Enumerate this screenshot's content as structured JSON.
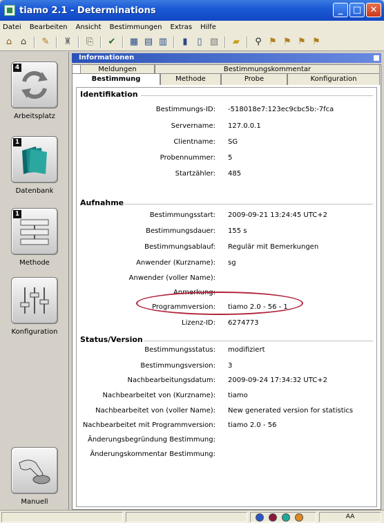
{
  "window": {
    "title": "tiamo 2.1 - Determinations"
  },
  "menu": [
    "Datei",
    "Bearbeiten",
    "Ansicht",
    "Bestimmungen",
    "Extras",
    "Hilfe"
  ],
  "sidebar": {
    "items": [
      {
        "label": "Arbeitsplatz",
        "badge": "4"
      },
      {
        "label": "Datenbank",
        "badge": "1"
      },
      {
        "label": "Methode",
        "badge": "1"
      },
      {
        "label": "Konfiguration",
        "badge": ""
      },
      {
        "label": "Manuell",
        "badge": ""
      }
    ]
  },
  "panel": {
    "title": "Informationen",
    "tabs_top": [
      "Meldungen",
      "Bestimmungskommentar"
    ],
    "tabs_bottom": [
      "Bestimmung",
      "Methode",
      "Probe",
      "Konfiguration"
    ]
  },
  "sections": {
    "identifikation": "Identifikation",
    "aufnahme": "Aufnahme",
    "status": "Status/Version"
  },
  "fields": {
    "bestimmungs_id": {
      "label": "Bestimmungs-ID:",
      "value": "-518018e7:123ec9cbc5b:-7fca"
    },
    "servername": {
      "label": "Servername:",
      "value": "127.0.0.1"
    },
    "clientname": {
      "label": "Clientname:",
      "value": "SG"
    },
    "probennummer": {
      "label": "Probennummer:",
      "value": "5"
    },
    "startzaehler": {
      "label": "Startzähler:",
      "value": "485"
    },
    "bestimmungsstart": {
      "label": "Bestimmungsstart:",
      "value": "2009-09-21 13:24:45 UTC+2"
    },
    "bestimmungsdauer": {
      "label": "Bestimmungsdauer:",
      "value": "155 s"
    },
    "bestimmungsablauf": {
      "label": "Bestimmungsablauf:",
      "value": "Regulär mit Bemerkungen"
    },
    "anwender_kurz": {
      "label": "Anwender (Kurzname):",
      "value": "sg"
    },
    "anwender_voll": {
      "label": "Anwender (voller Name):",
      "value": ""
    },
    "anmerkung": {
      "label": "Anmerkung:",
      "value": ""
    },
    "programmversion": {
      "label": "Programmversion:",
      "value": "tiamo 2.0 - 56 - 1"
    },
    "lizenz_id": {
      "label": "Lizenz-ID:",
      "value": "6274773"
    },
    "bestimmungsstatus": {
      "label": "Bestimmungsstatus:",
      "value": "modifiziert"
    },
    "bestimmungsversion": {
      "label": "Bestimmungsversion:",
      "value": "3"
    },
    "nachbearbeitungsdatum": {
      "label": "Nachbearbeitungsdatum:",
      "value": "2009-09-24 17:34:32 UTC+2"
    },
    "nachbearbeitet_kurz": {
      "label": "Nachbearbeitet von (Kurzname):",
      "value": "tiamo"
    },
    "nachbearbeitet_voll": {
      "label": "Nachbearbeitet von (voller Name):",
      "value": "New generated version for statistics"
    },
    "nachbearbeitet_programm": {
      "label": "Nachbearbeitet mit Programmversion:",
      "value": "tiamo 2.0 - 56"
    },
    "aenderungsbegruendung": {
      "label": "Änderungsbegründung Bestimmung:",
      "value": ""
    },
    "aenderungskommentar": {
      "label": "Änderungskommentar Bestimmung:",
      "value": ""
    }
  },
  "statusbar": {
    "right_text": "AA"
  },
  "colors": {
    "dot1": "#2a56c8",
    "dot2": "#8a1a3a",
    "dot3": "#20a898",
    "dot4": "#e08a20",
    "highlight": "#b0203a"
  }
}
